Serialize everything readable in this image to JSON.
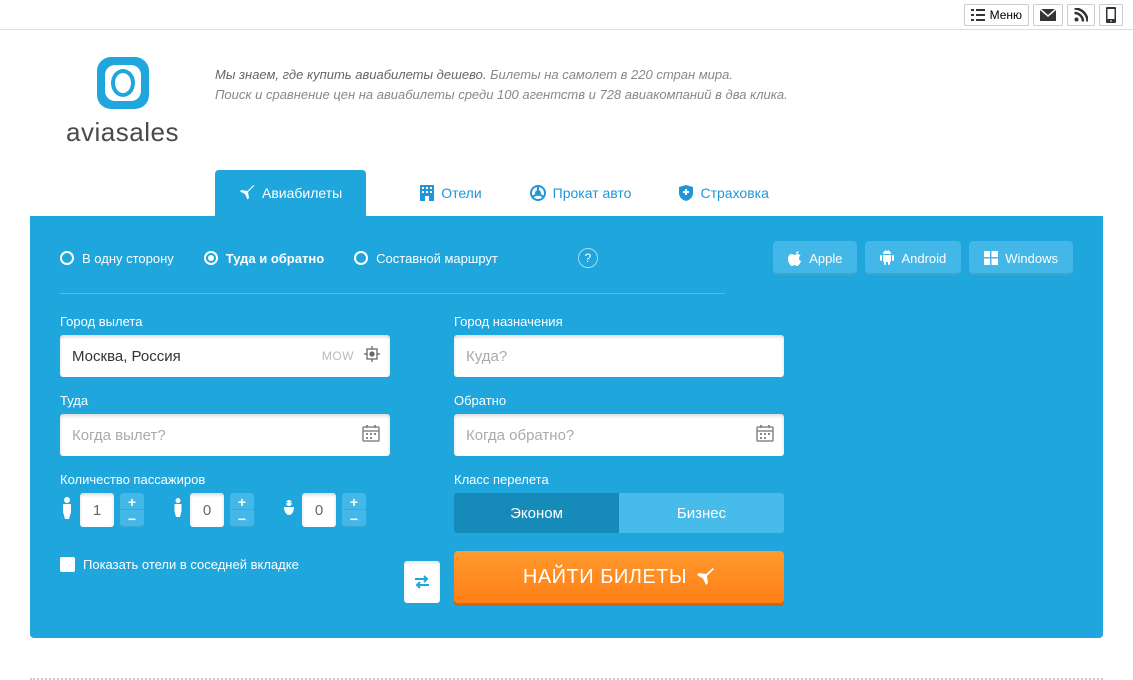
{
  "topbar": {
    "menu": "Меню"
  },
  "logo": {
    "name": "aviasales"
  },
  "tagline": {
    "lead": "Мы знаем, где купить авиабилеты дешево.",
    "rest": " Билеты на самолет в 220 стран мира.",
    "line2": "Поиск и сравнение цен на авиабилеты среди 100 агентств и 728 авиакомпаний в два клика."
  },
  "tabs": {
    "flights": "Авиабилеты",
    "hotels": "Отели",
    "cars": "Прокат авто",
    "insurance": "Страховка"
  },
  "triptype": {
    "oneway": "В одну сторону",
    "round": "Туда и обратно",
    "multi": "Составной маршрут"
  },
  "apps": {
    "apple": "Apple",
    "android": "Android",
    "windows": "Windows"
  },
  "form": {
    "from_label": "Город вылета",
    "from_value": "Москва, Россия",
    "from_iata": "MOW",
    "to_label": "Город назначения",
    "to_placeholder": "Куда?",
    "depart_label": "Туда",
    "depart_placeholder": "Когда вылет?",
    "return_label": "Обратно",
    "return_placeholder": "Когда обратно?",
    "pax_label": "Количество пассажиров",
    "pax_adult": "1",
    "pax_child": "0",
    "pax_infant": "0",
    "class_label": "Класс перелета",
    "class_econ": "Эконом",
    "class_biz": "Бизнес",
    "hotels_check": "Показать отели в соседней вкладке",
    "search": "НАЙТИ БИЛЕТЫ"
  }
}
